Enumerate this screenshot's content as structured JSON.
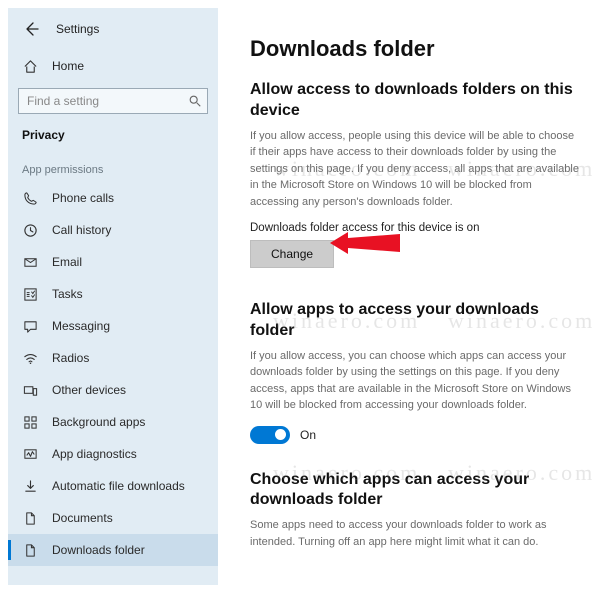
{
  "sidebar": {
    "app_title": "Settings",
    "home_label": "Home",
    "search_placeholder": "Find a setting",
    "section_label": "Privacy",
    "group_label": "App permissions",
    "items": [
      {
        "icon": "phone",
        "label": "Phone calls"
      },
      {
        "icon": "clock",
        "label": "Call history"
      },
      {
        "icon": "mail",
        "label": "Email"
      },
      {
        "icon": "checklist",
        "label": "Tasks"
      },
      {
        "icon": "message",
        "label": "Messaging"
      },
      {
        "icon": "wifi",
        "label": "Radios"
      },
      {
        "icon": "devices",
        "label": "Other devices"
      },
      {
        "icon": "grid",
        "label": "Background apps"
      },
      {
        "icon": "diagnostics",
        "label": "App diagnostics"
      },
      {
        "icon": "download",
        "label": "Automatic file downloads"
      },
      {
        "icon": "document",
        "label": "Documents"
      },
      {
        "icon": "document",
        "label": "Downloads folder",
        "active": true
      }
    ]
  },
  "main": {
    "title": "Downloads folder",
    "section1": {
      "heading": "Allow access to downloads folders on this device",
      "desc": "If you allow access, people using this device will be able to choose if their apps have access to their downloads folder by using the settings on this page. If you deny access, all apps that are available in the Microsoft Store on Windows 10 will be blocked from accessing any person's downloads folder.",
      "status_line": "Downloads folder access for this device is on",
      "change_label": "Change"
    },
    "section2": {
      "heading": "Allow apps to access your downloads folder",
      "desc": "If you allow access, you can choose which apps can access your downloads folder by using the settings on this page. If you deny access, apps that are available in the Microsoft Store on Windows 10 will be blocked from accessing your downloads folder.",
      "toggle_label": "On",
      "toggle_state": true
    },
    "section3": {
      "heading": "Choose which apps can access your downloads folder",
      "desc": "Some apps need to access your downloads folder to work as intended. Turning off an app here might limit what it can do."
    }
  },
  "watermark": "winaero.com"
}
